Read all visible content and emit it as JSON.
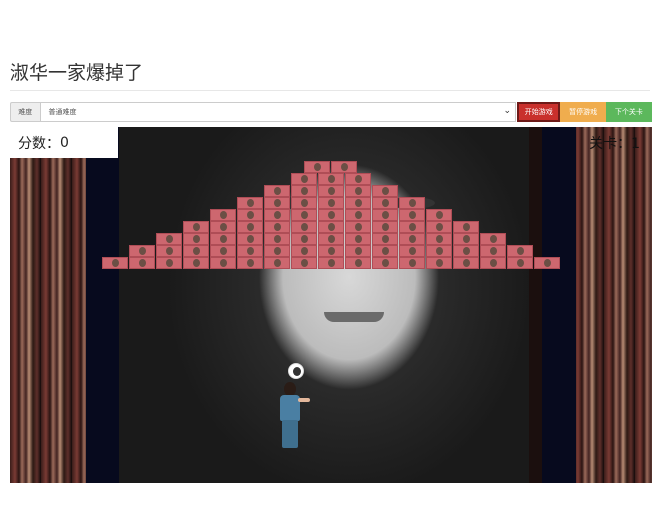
{
  "page": {
    "title": "淑华一家爆掉了"
  },
  "toolbar": {
    "difficulty_label": "难度",
    "difficulty_value": "普通难度",
    "start_label": "开始游戏",
    "pause_label": "暂停游戏",
    "next_label": "下个关卡"
  },
  "game": {
    "score_label": "分数：",
    "score": "0",
    "level_label": "关卡：",
    "level": "1"
  },
  "colors": {
    "start": "#c9302c",
    "pause": "#f0ad4e",
    "next": "#5cb85c",
    "brick": "#cd676f"
  },
  "icons": [
    "chevron-down-icon"
  ],
  "bricks": {
    "row_counts": [
      2,
      3,
      5,
      7,
      9,
      11,
      13,
      15,
      17
    ]
  }
}
